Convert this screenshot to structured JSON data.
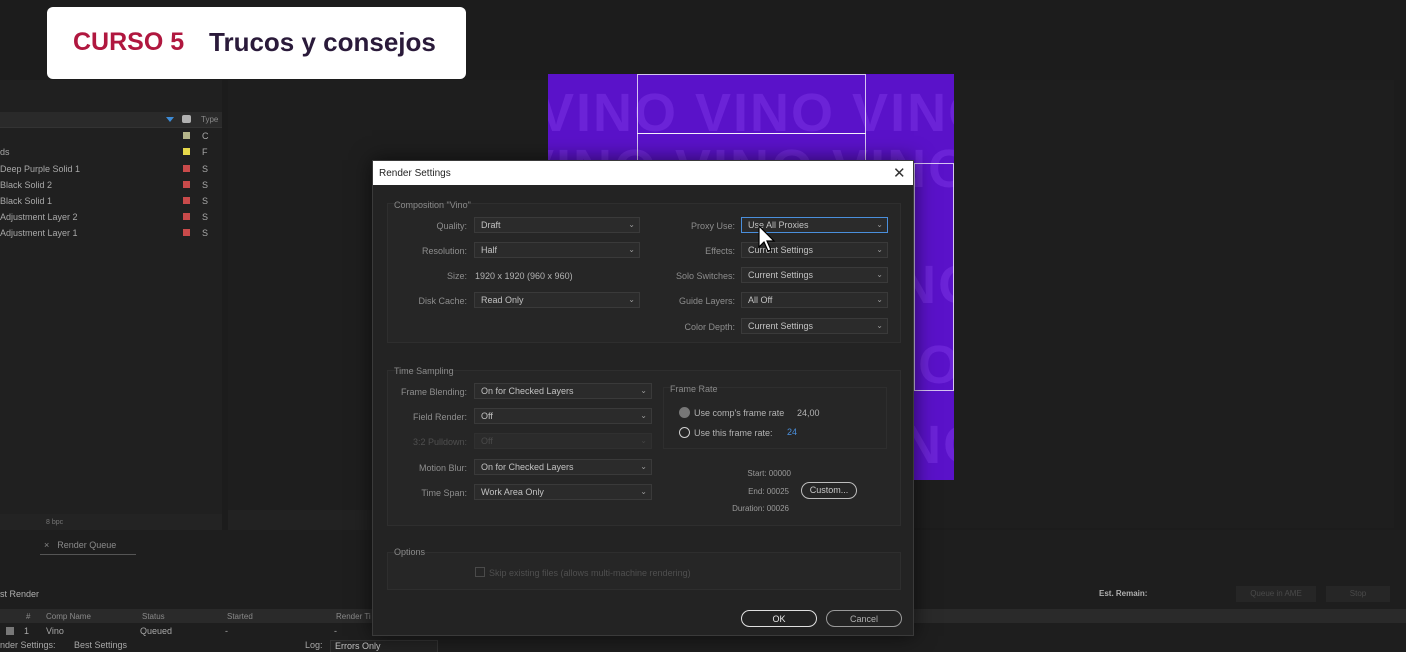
{
  "badge": {
    "course": "CURSO 5",
    "title": "Trucos y consejos"
  },
  "project": {
    "type_header": "Type",
    "rows": [
      {
        "name": "",
        "type": "C",
        "color": "#b5b58a"
      },
      {
        "name": "ds",
        "type": "F",
        "color": "#e6d84a"
      },
      {
        "name": "Deep Purple Solid 1",
        "type": "S",
        "color": "#c94a4a"
      },
      {
        "name": "Black Solid 2",
        "type": "S",
        "color": "#c94a4a"
      },
      {
        "name": "Black Solid 1",
        "type": "S",
        "color": "#c94a4a"
      },
      {
        "name": "Adjustment Layer 2",
        "type": "S",
        "color": "#c94a4a"
      },
      {
        "name": "Adjustment Layer 1",
        "type": "S",
        "color": "#c94a4a"
      }
    ],
    "bpc": "8 bpc"
  },
  "comp": {
    "watermark": "VINO VINO VINO"
  },
  "render_queue": {
    "tab": "Render Queue",
    "current_render": "st Render",
    "est_remain": "Est. Remain:",
    "queue_ame": "Queue in AME",
    "stop": "Stop",
    "columns": [
      "#",
      "Comp Name",
      "Status",
      "Started",
      "Render Ti"
    ],
    "row": {
      "num": "1",
      "comp": "Vino",
      "status": "Queued",
      "started": "-",
      "render_time": "-"
    },
    "render_settings_label": "nder Settings:",
    "render_settings_value": "Best Settings",
    "log_label": "Log:",
    "log_value": "Errors Only"
  },
  "dialog": {
    "title": "Render Settings",
    "composition_group": "Composition \"Vino\"",
    "quality_label": "Quality:",
    "quality": "Draft",
    "resolution_label": "Resolution:",
    "resolution": "Half",
    "size_label": "Size:",
    "size": "1920 x 1920 (960 x 960)",
    "disk_cache_label": "Disk Cache:",
    "disk_cache": "Read Only",
    "proxy_use_label": "Proxy Use:",
    "proxy_use": "Use All Proxies",
    "effects_label": "Effects:",
    "effects": "Current Settings",
    "solo_switches_label": "Solo Switches:",
    "solo_switches": "Current Settings",
    "guide_layers_label": "Guide Layers:",
    "guide_layers": "All Off",
    "color_depth_label": "Color Depth:",
    "color_depth": "Current Settings",
    "time_sampling_group": "Time Sampling",
    "frame_blending_label": "Frame Blending:",
    "frame_blending": "On for Checked Layers",
    "field_render_label": "Field Render:",
    "field_render": "Off",
    "pulldown_label": "3:2 Pulldown:",
    "pulldown": "Off",
    "motion_blur_label": "Motion Blur:",
    "motion_blur": "On for Checked Layers",
    "time_span_label": "Time Span:",
    "time_span": "Work Area Only",
    "frame_rate_group": "Frame Rate",
    "use_comp_rate_label": "Use comp's frame rate",
    "use_comp_rate_value": "24,00",
    "use_this_rate_label": "Use this frame rate:",
    "use_this_rate_value": "24",
    "start": "Start: 00000",
    "end": "End: 00025",
    "duration": "Duration: 00026",
    "custom_button": "Custom...",
    "options_group": "Options",
    "skip_existing": "Skip existing files (allows multi-machine rendering)",
    "ok": "OK",
    "cancel": "Cancel"
  }
}
